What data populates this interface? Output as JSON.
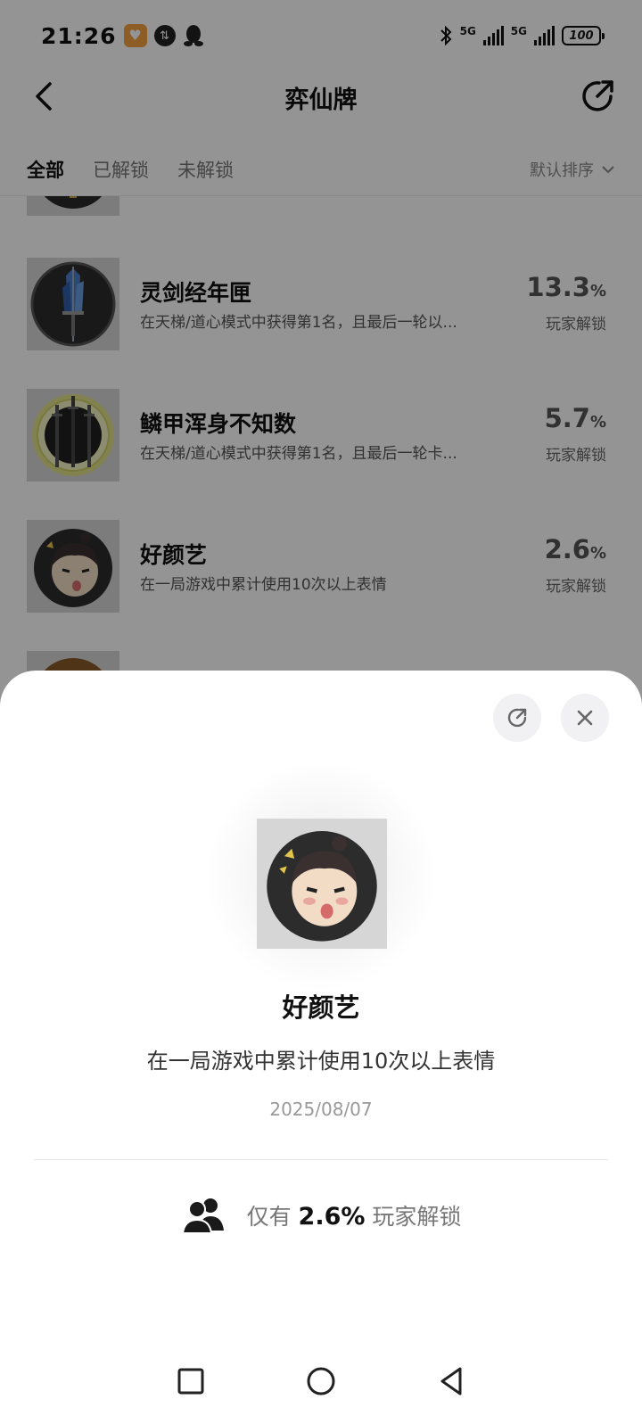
{
  "status_bar": {
    "time": "21:26",
    "network_1": "5G",
    "network_2": "5G",
    "battery": "100",
    "icons": [
      "app-icon",
      "data-icon",
      "qq-icon",
      "bluetooth-icon",
      "signal-icon",
      "signal-icon",
      "battery-icon"
    ]
  },
  "header": {
    "title": "弈仙牌",
    "back_icon": "chevron-left-icon",
    "share_icon": "share-icon"
  },
  "tabs": {
    "items": [
      "全部",
      "已解锁",
      "未解锁"
    ],
    "active": "全部",
    "sort_label": "默认排序"
  },
  "achievements": [
    {
      "title": "灵剑经年匣",
      "desc": "在天梯/道心模式中获得第1名，且最后一轮以...",
      "pct": "13.3",
      "pct_unit": "%",
      "unlock_label": "玩家解锁",
      "icon": "sword-box-icon"
    },
    {
      "title": "鳞甲浑身不知数",
      "desc": "在天梯/道心模式中获得第1名，且最后一轮卡...",
      "pct": "5.7",
      "pct_unit": "%",
      "unlock_label": "玩家解锁",
      "icon": "three-swords-icon"
    },
    {
      "title": "好颜艺",
      "desc": "在一局游戏中累计使用10次以上表情",
      "pct": "2.6",
      "pct_unit": "%",
      "unlock_label": "玩家解锁",
      "icon": "funny-face-icon"
    }
  ],
  "detail_sheet": {
    "title": "好颜艺",
    "desc": "在一局游戏中累计使用10次以上表情",
    "date": "2025/08/07",
    "stat_prefix": "仅有",
    "stat_value": "2.6%",
    "stat_suffix": "玩家解锁",
    "share_icon": "share-icon",
    "close_icon": "close-icon",
    "stat_icon": "users-icon"
  },
  "nav_bar": {
    "icons": [
      "recents-square-icon",
      "home-circle-icon",
      "back-triangle-icon"
    ]
  },
  "colors": {
    "overlay": "#000000",
    "sheet_bg": "#ffffff",
    "accent_app": "#f5a042"
  }
}
